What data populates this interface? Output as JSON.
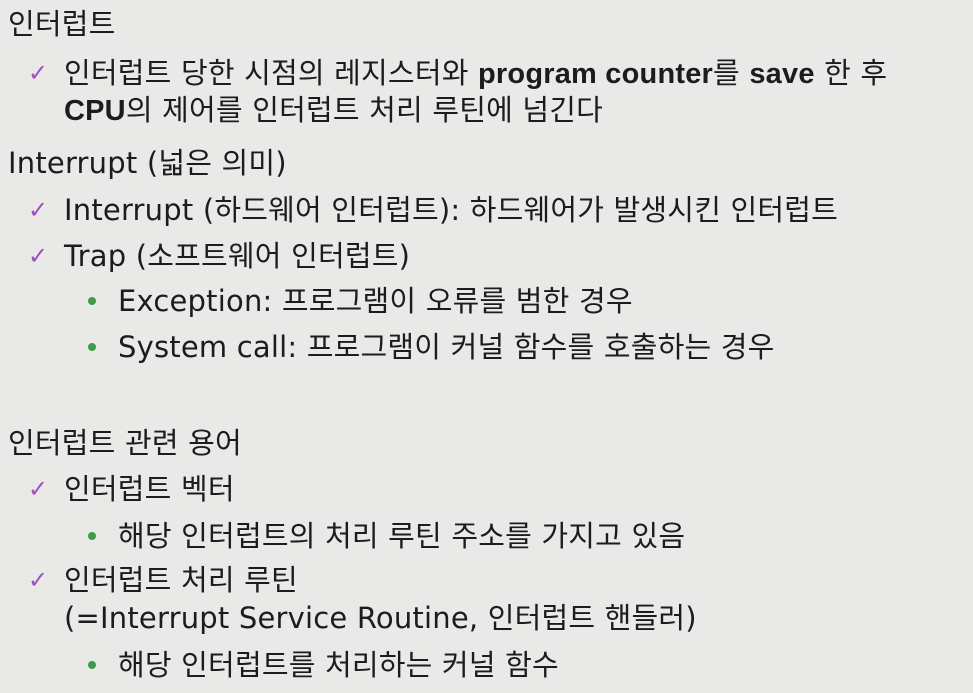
{
  "section1": {
    "heading": "인터럽트",
    "item1": {
      "part_a": "인터럽트 당한 시점의 레지스터와 ",
      "bold_a": "program counter",
      "part_b": "를 ",
      "bold_b": "save",
      "part_c": " 한 후",
      "line2_bold": "CPU",
      "line2_rest": "의 제어를 인터럽트 처리 루틴에 넘긴다"
    }
  },
  "section2": {
    "heading": "Interrupt (넓은 의미)",
    "items": [
      {
        "text": "Interrupt (하드웨어 인터럽트): 하드웨어가 발생시킨 인터럽트"
      },
      {
        "text": "Trap (소프트웨어 인터럽트)"
      }
    ],
    "subitems": [
      {
        "text": "Exception: 프로그램이 오류를 범한 경우"
      },
      {
        "text": "System call: 프로그램이 커널 함수를 호출하는 경우"
      }
    ]
  },
  "section3": {
    "heading": "인터럽트 관련 용어",
    "item1": "인터럽트 벡터",
    "item1_sub": "해당 인터럽트의 처리 루틴 주소를 가지고 있음",
    "item2": "인터럽트 처리 루틴",
    "item2_cont": "(=Interrupt Service Routine, 인터럽트 핸들러)",
    "item2_sub": "해당 인터럽트를 처리하는 커널 함수"
  },
  "icons": {
    "check": "check-icon",
    "bullet": "bullet-dot-icon"
  },
  "colors": {
    "background": "#e9e9e7",
    "check": "#a14fc4",
    "bullet": "#3f9a4a",
    "text": "#1c1c1c"
  }
}
